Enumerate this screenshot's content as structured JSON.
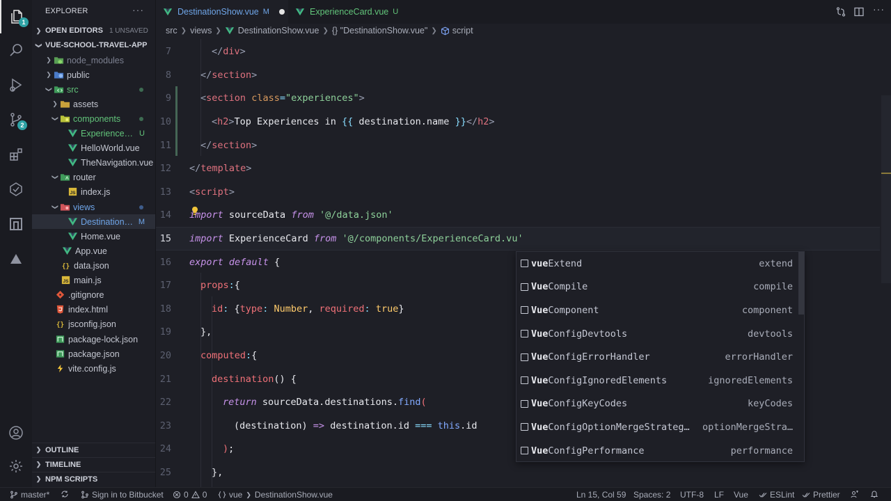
{
  "activity": {
    "explorer_badge": "1",
    "scm_badge": "2"
  },
  "sidebar": {
    "title": "EXPLORER",
    "more": "···",
    "open_editors": {
      "label": "OPEN EDITORS",
      "extra": "1 UNSAVED"
    },
    "project": {
      "label": "VUE-SCHOOL-TRAVEL-APP"
    },
    "tree": [
      {
        "name": "node_modules",
        "icon": "folder-node-icon"
      },
      {
        "name": "public",
        "icon": "folder-public-icon"
      },
      {
        "name": "src",
        "icon": "folder-src-icon"
      },
      {
        "name": "assets",
        "icon": "folder-assets-icon"
      },
      {
        "name": "components",
        "icon": "folder-components-icon"
      },
      {
        "name": "ExperienceCard.vue",
        "icon": "vue-file-icon",
        "status": "U"
      },
      {
        "name": "HelloWorld.vue",
        "icon": "vue-file-icon"
      },
      {
        "name": "TheNavigation.vue",
        "icon": "vue-file-icon"
      },
      {
        "name": "router",
        "icon": "folder-router-icon"
      },
      {
        "name": "index.js",
        "icon": "js-file-icon"
      },
      {
        "name": "views",
        "icon": "folder-views-icon"
      },
      {
        "name": "DestinationShow.vue",
        "icon": "vue-file-icon",
        "status": "M"
      },
      {
        "name": "Home.vue",
        "icon": "vue-file-icon"
      },
      {
        "name": "App.vue",
        "icon": "vue-file-icon"
      },
      {
        "name": "data.json",
        "icon": "json-file-icon"
      },
      {
        "name": "main.js",
        "icon": "js-file-icon"
      },
      {
        "name": ".gitignore",
        "icon": "git-file-icon"
      },
      {
        "name": "index.html",
        "icon": "html-file-icon"
      },
      {
        "name": "jsconfig.json",
        "icon": "json-file-icon"
      },
      {
        "name": "package-lock.json",
        "icon": "npm-file-icon"
      },
      {
        "name": "package.json",
        "icon": "npm-file-icon"
      },
      {
        "name": "vite.config.js",
        "icon": "vite-file-icon"
      }
    ],
    "outline": "OUTLINE",
    "timeline": "TIMELINE",
    "npm_scripts": "NPM SCRIPTS"
  },
  "tabs": [
    {
      "name": "DestinationShow.vue",
      "status": "M",
      "active": true,
      "dirty": true
    },
    {
      "name": "ExperienceCard.vue",
      "status": "U",
      "active": false
    }
  ],
  "breadcrumb": [
    "src",
    "views",
    "DestinationShow.vue",
    "{} \"DestinationShow.vue\"",
    "script"
  ],
  "editor": {
    "current_line": "15",
    "lines": [
      {
        "n": "7"
      },
      {
        "n": "8"
      },
      {
        "n": "9"
      },
      {
        "n": "10"
      },
      {
        "n": "11"
      },
      {
        "n": "12"
      },
      {
        "n": "13"
      },
      {
        "n": "14"
      },
      {
        "n": "15"
      },
      {
        "n": "16"
      },
      {
        "n": "17"
      },
      {
        "n": "18"
      },
      {
        "n": "19"
      },
      {
        "n": "20"
      },
      {
        "n": "21"
      },
      {
        "n": "22"
      },
      {
        "n": "23"
      },
      {
        "n": "24"
      },
      {
        "n": "25"
      }
    ]
  },
  "suggest": {
    "items": [
      {
        "match": "vue",
        "rest": "Extend",
        "detail": "extend"
      },
      {
        "match": "Vue",
        "rest": "Compile",
        "detail": "compile"
      },
      {
        "match": "Vue",
        "rest": "Component",
        "detail": "component"
      },
      {
        "match": "Vue",
        "rest": "ConfigDevtools",
        "detail": "devtools"
      },
      {
        "match": "Vue",
        "rest": "ConfigErrorHandler",
        "detail": "errorHandler"
      },
      {
        "match": "Vue",
        "rest": "ConfigIgnoredElements",
        "detail": "ignoredElements"
      },
      {
        "match": "Vue",
        "rest": "ConfigKeyCodes",
        "detail": "keyCodes"
      },
      {
        "match": "Vue",
        "rest": "ConfigOptionMergeStrateg…",
        "detail": "optionMergeStra…"
      },
      {
        "match": "Vue",
        "rest": "ConfigPerformance",
        "detail": "performance"
      }
    ]
  },
  "status": {
    "branch": "master*",
    "bitbucket": "Sign in to Bitbucket",
    "errors": "0",
    "warnings": "0",
    "lang_crumb": "vue",
    "file_crumb": "DestinationShow.vue",
    "position": "Ln 15, Col 59",
    "spaces": "Spaces: 2",
    "encoding": "UTF-8",
    "eol": "LF",
    "language": "Vue",
    "eslint": "ESLint",
    "prettier": "Prettier"
  },
  "colors": {
    "accent_git_added": "#456655",
    "vue_green": "#41b883"
  }
}
